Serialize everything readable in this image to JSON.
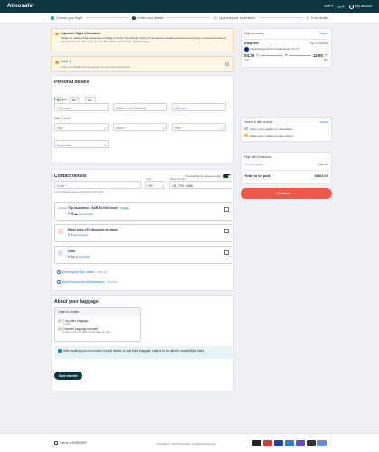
{
  "header": {
    "logo": "Almosafer",
    "currency": "SAR",
    "language": "عربي",
    "account": "My account"
  },
  "steps": [
    {
      "label": "Choose your flight",
      "state": "done"
    },
    {
      "label": "Enter your details",
      "state": "current"
    },
    {
      "label": "Upgrade your experience",
      "state": "pending"
    },
    {
      "label": "Final details",
      "state": "pending"
    }
  ],
  "notice": {
    "title": "Important flight information",
    "body": "Please be advised that passengers holding an Entry Visa (Family Visit) are permitted to depart and arrive exclusively on Kuwait Airways or Jazeera Airways. Traveling via any other airline will result in denial of entry."
  },
  "traveller": {
    "title": "Adult 1",
    "subtitle": "Enter your details as they appear on your travel document"
  },
  "personal": {
    "heading": "Personal details",
    "titles": [
      "Mr.",
      "Ms.",
      "Mrs."
    ],
    "fullname_label": "Full name",
    "first_name": "First name *",
    "middle_name": "Middle name (Optional)",
    "last_name": "Last name *",
    "dob_label": "Date of birth",
    "day": "Day *",
    "month": "Month *",
    "year": "Year *",
    "nationality": "Nationality *"
  },
  "contact": {
    "heading": "Contact details",
    "booking_for": "I'm booking for someone else",
    "email": "Email *",
    "email_hint": "Your purchased tickets will be sent to this email",
    "code_label": "Code *",
    "code": "+20",
    "mobile_label": "Mobile number *",
    "mobile": "115 - 793 - 4060"
  },
  "addons": [
    {
      "title": "Trip Insurance - SAR 20,000 Cover",
      "tag": "Popular",
      "price": "20",
      "old": "20",
      "link": "View benefits"
    },
    {
      "title": "Enjoy upto 12% discount on stays",
      "tag": "",
      "price": "0",
      "old": "",
      "link": "View benefits"
    },
    {
      "title": "eSIM",
      "tag": "",
      "price": "3",
      "old": "5",
      "link": "View benefits"
    }
  ],
  "extras": [
    {
      "label": "Add frequent flyer details",
      "optional": "Optional"
    },
    {
      "label": "Add meal and special assistance",
      "optional": "Optional"
    }
  ],
  "baggage": {
    "heading": "About your baggage",
    "cabin_title": "Cabin to Jeddah",
    "items": [
      {
        "label": "7 kg cabin baggage",
        "sub": "1 piece"
      },
      {
        "label": "Checked baggage included",
        "sub": "2 pieces, airline usually permits 50kg per bag"
      }
    ],
    "info": "After booking, you can contact a travel advisor to add extra baggage, subject to the airline's availability & rates.",
    "save": "Save traveller"
  },
  "summary": {
    "title": "Flight summary",
    "details": "Details",
    "departure": "Departure",
    "date": "Thu, 31 Jul 2025",
    "airline": "Kuwait Airways KU 114, Kuwait Airways KU 777",
    "dep_time": "04:20",
    "dep_day": "Thu",
    "dep_airport": "CAI",
    "arr_time": "11:05",
    "arr_day": "Thu",
    "arr_airport": "JED"
  },
  "cancel": {
    "title": "Cancel & date change",
    "details": "Details",
    "p1": "Airline policy applies for cancellation",
    "p2": "Airline policy applies for date change"
  },
  "fare": {
    "title": "Flight fare breakdown",
    "traveller": "Traveller Adult 1",
    "traveller_price": "4,863.00",
    "total_label": "Total to be paid",
    "total": "4,863.00",
    "continue": "Continue"
  },
  "footer": {
    "call": "Call us at 920000997",
    "copyright": "Copyright © 2025 Almosafer. All Rights Reserved."
  },
  "colors": {
    "brand": "#0c3640",
    "accent": "#f0584b",
    "link": "#1e6fd9"
  }
}
